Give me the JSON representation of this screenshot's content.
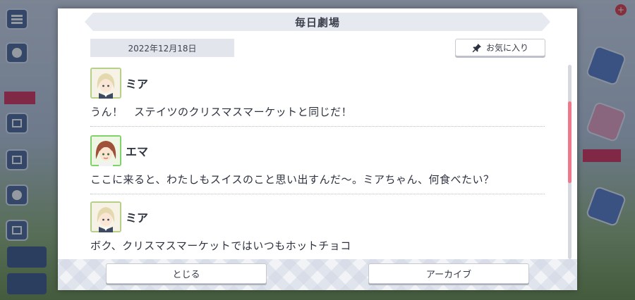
{
  "dialog": {
    "title": "毎日劇場",
    "date": "2022年12月18日",
    "favorite_label": "お気に入り"
  },
  "entries": [
    {
      "speaker": "ミア",
      "avatar": "mia-avatar",
      "text": "うん！　ステイツのクリスマスマーケットと同じだ！"
    },
    {
      "speaker": "エマ",
      "avatar": "emma-avatar",
      "text": "ここに来ると、わたしもスイスのこと思い出すんだ〜。ミアちゃん、何食べたい？"
    },
    {
      "speaker": "ミア",
      "avatar": "mia-avatar",
      "text": "ボク、クリスマスマーケットではいつもホットチョコ"
    }
  ],
  "footer": {
    "close_label": "とじる",
    "archive_label": "アーカイブ"
  },
  "colors": {
    "accent": "#f0788d",
    "mia_frame": "#b6d08a",
    "emma_frame": "#7fd36a"
  },
  "scroll": {
    "position_fraction": 0.25
  }
}
